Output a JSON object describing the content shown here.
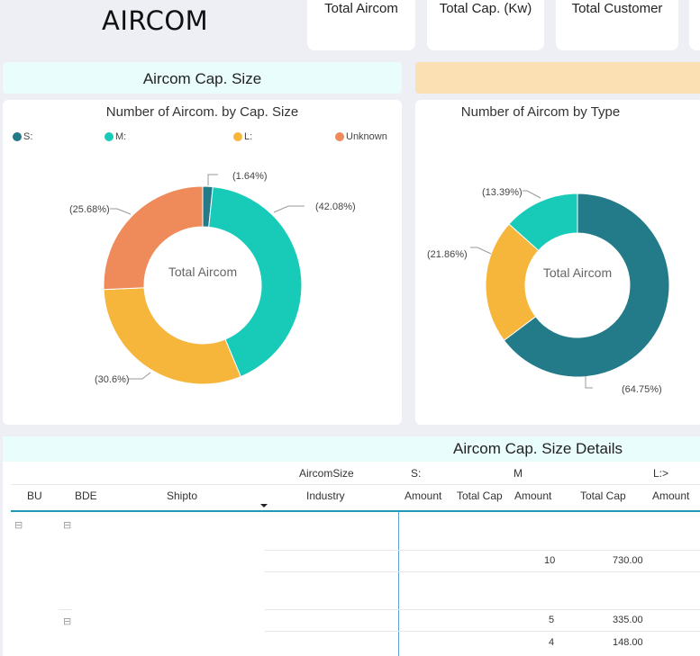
{
  "header": {
    "title": "AIRCOM"
  },
  "kpis": [
    {
      "label": "Total Aircom"
    },
    {
      "label": "Total Cap. (Kw)"
    },
    {
      "label": "Total Customer"
    }
  ],
  "bands": {
    "left": "Aircom Cap. Size",
    "right": ""
  },
  "cap_chart": {
    "title": "Number of Aircom. by Cap. Size",
    "center_label": "Total Aircom",
    "legend": [
      {
        "label": "S:",
        "color": "#237b8a"
      },
      {
        "label": "M:",
        "color": "#18cbb9"
      },
      {
        "label": "L:",
        "color": "#f6b53b"
      },
      {
        "label": "Unknown",
        "color": "#ef8a5b"
      }
    ],
    "labels": [
      "(1.64%)",
      "(42.08%)",
      "(30.6%)",
      "(25.68%)"
    ]
  },
  "type_chart": {
    "title": "Number of Aircom by Type",
    "center_label": "Total Aircom",
    "labels": [
      "(64.75%)",
      "(21.86%)",
      "(13.39%)"
    ]
  },
  "chart_data": [
    {
      "type": "pie",
      "title": "Number of Aircom. by Cap. Size",
      "categories": [
        "S:",
        "M:",
        "L:",
        "Unknown"
      ],
      "values": [
        1.64,
        42.08,
        30.6,
        25.68
      ],
      "colors": [
        "#237b8a",
        "#18cbb9",
        "#f6b53b",
        "#ef8a5b"
      ],
      "legend": "top"
    },
    {
      "type": "pie",
      "title": "Number of Aircom by Type",
      "categories": [
        "",
        "",
        ""
      ],
      "values": [
        64.75,
        21.86,
        13.39
      ],
      "colors": [
        "#237b8a",
        "#f6b53b",
        "#18cbb9"
      ]
    }
  ],
  "table": {
    "title": "Aircom Cap. Size Details",
    "group_header": {
      "field": "AircomSize",
      "s": "S:",
      "m": "M",
      "l": "L:>"
    },
    "columns": [
      "BU",
      "BDE",
      "Shipto",
      "Industry",
      "Amount",
      "Total Cap",
      "Amount",
      "Total Cap",
      "Amount"
    ],
    "rows": [
      {
        "m_amount": "10",
        "m_cap": "730.00"
      },
      {
        "m_amount": "5",
        "m_cap": "335.00"
      },
      {
        "m_amount": "4",
        "m_cap": "148.00"
      }
    ],
    "expand_icon": "⊟"
  }
}
